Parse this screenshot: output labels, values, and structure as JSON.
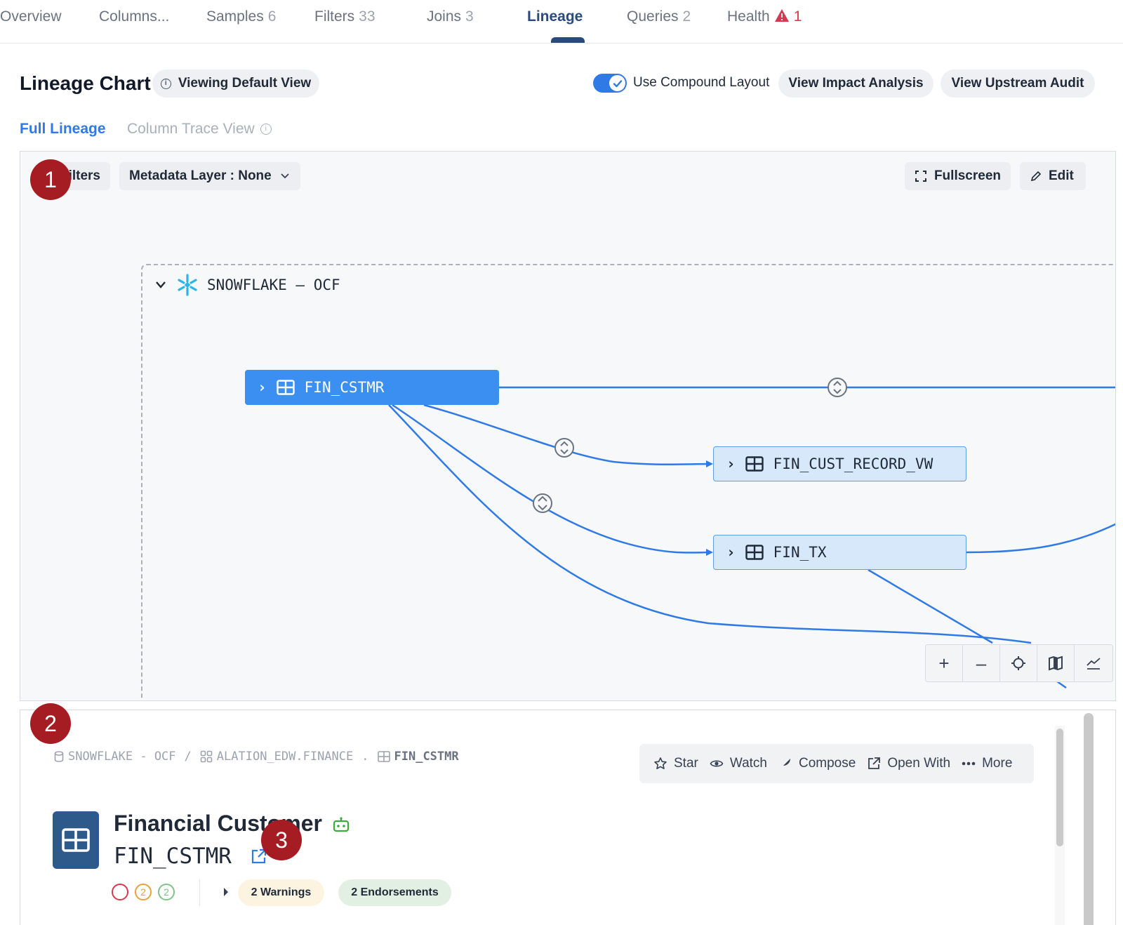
{
  "tabs": [
    {
      "label": "Overview",
      "count": ""
    },
    {
      "label": "Columns...",
      "count": ""
    },
    {
      "label": "Samples",
      "count": "6"
    },
    {
      "label": "Filters",
      "count": "33"
    },
    {
      "label": "Joins",
      "count": "3"
    },
    {
      "label": "Lineage",
      "count": ""
    },
    {
      "label": "Queries",
      "count": "2"
    },
    {
      "label": "Health",
      "count": "1"
    }
  ],
  "header": {
    "title": "Lineage Chart",
    "view_pill": "Viewing Default View",
    "toggle_label": "Use Compound Layout",
    "toggle_on": true,
    "impact_button": "View Impact Analysis",
    "upstream_button": "View Upstream Audit"
  },
  "subtabs": {
    "full": "Full Lineage",
    "column_trace": "Column Trace View"
  },
  "canvas": {
    "filters_label": "Filters",
    "metadata_layer": "Metadata Layer : None",
    "fullscreen": "Fullscreen",
    "edit": "Edit",
    "group_name": "SNOWFLAKE – OCF",
    "nodes": {
      "source": "FIN_CSTMR",
      "target1": "FIN_CUST_RECORD_VW",
      "target2": "FIN_TX"
    },
    "zoom": {
      "plus": "+",
      "minus": "–"
    }
  },
  "callouts": [
    "1",
    "2",
    "3"
  ],
  "details": {
    "breadcrumb": {
      "datasource": "SNOWFLAKE - OCF",
      "schema": "ALATION_EDW.FINANCE",
      "separator1": "/",
      "separator2": ".",
      "table": "FIN_CSTMR"
    },
    "actions": {
      "star": "Star",
      "watch": "Watch",
      "compose": "Compose",
      "open_with": "Open With",
      "more": "More"
    },
    "title": "Financial Customer",
    "name": "FIN_CSTMR",
    "status_counts": {
      "warnings_small": "2",
      "endorse_small": "2"
    },
    "warnings_chip": "2 Warnings",
    "endorsements_chip": "2 Endorsements"
  },
  "colors": {
    "accent": "#2f7ae5",
    "node_primary": "#3b8ff0",
    "node_secondary": "#d7e8fb",
    "edge": "#2f7ae5",
    "callout": "#a51d22",
    "warning_chip": "#fdf3e1",
    "endorse_chip": "#e1f0e3"
  }
}
